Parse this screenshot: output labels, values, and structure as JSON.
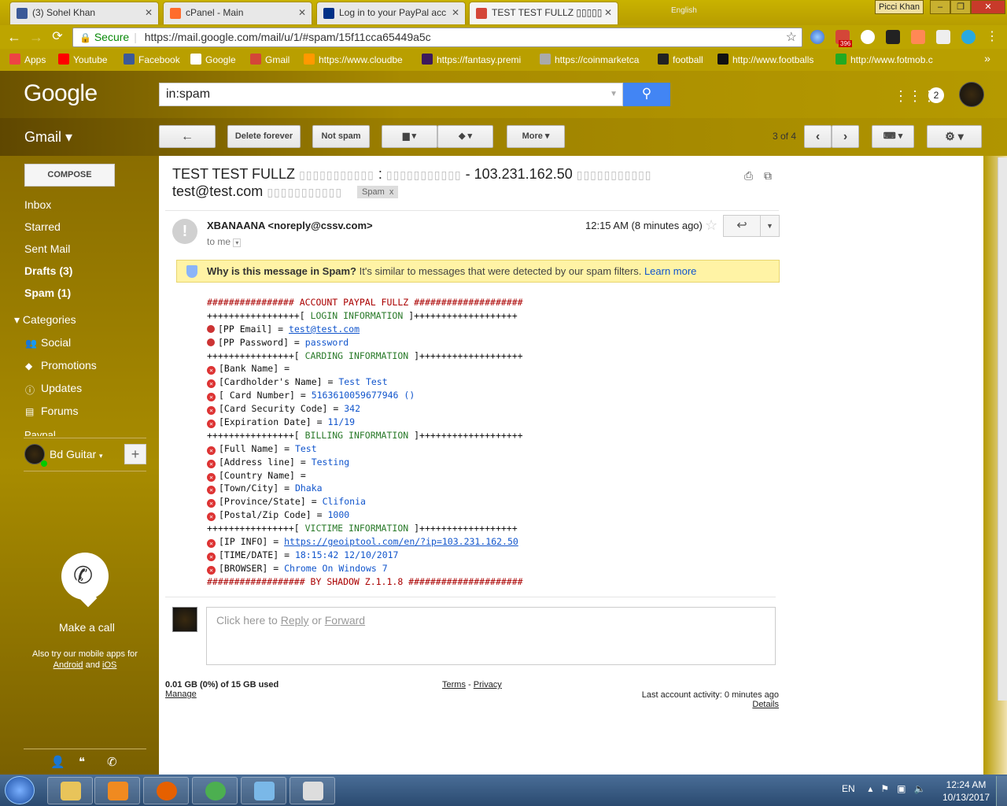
{
  "browser": {
    "tabs": [
      {
        "label": "(3) Sohel Khan",
        "icon": "facebook-icon",
        "color": "#3b5998"
      },
      {
        "label": "cPanel - Main",
        "icon": "cpanel-icon",
        "color": "#ff6c2c"
      },
      {
        "label": "Log in to your PayPal acc",
        "icon": "paypal-icon",
        "color": "#003087"
      },
      {
        "label": "TEST TEST FULLZ ▯▯▯▯▯",
        "icon": "gmail-icon",
        "color": "#d44638"
      }
    ],
    "profile_name": "Picci Khan",
    "language": "English",
    "omnibox": {
      "secure_label": "Secure",
      "url": "https://mail.google.com/mail/u/1/#spam/15f11cca65449a5c"
    },
    "bookmarks": [
      {
        "label": "Apps",
        "color": "#e44"
      },
      {
        "label": "Youtube",
        "color": "#f00"
      },
      {
        "label": "Facebook",
        "color": "#3b5998"
      },
      {
        "label": "Google",
        "color": "#fff"
      },
      {
        "label": "Gmail",
        "color": "#d44638"
      },
      {
        "label": "https://www.cloudbe",
        "color": "#f90"
      },
      {
        "label": "https://fantasy.premi",
        "color": "#3d195b"
      },
      {
        "label": "https://coinmarketca",
        "color": "#aaa"
      },
      {
        "label": "football",
        "color": "#222"
      },
      {
        "label": "http://www.footballs",
        "color": "#111"
      },
      {
        "label": "http://www.fotmob.c",
        "color": "#2a2"
      }
    ],
    "ext_badge": "396"
  },
  "gmail": {
    "logo": "Google",
    "search_query": "in:spam",
    "notifications": "2",
    "app_label": "Gmail",
    "toolbar": {
      "back_label": "←",
      "delete_label": "Delete forever",
      "notspam_label": "Not spam",
      "more_label": "More",
      "page_count": "3 of 4"
    },
    "compose_label": "COMPOSE",
    "nav": [
      {
        "label": "Inbox",
        "bold": false
      },
      {
        "label": "Starred",
        "bold": false
      },
      {
        "label": "Sent Mail",
        "bold": false
      },
      {
        "label": "Drafts (3)",
        "bold": true
      },
      {
        "label": "Spam (1)",
        "bold": true
      }
    ],
    "categories_label": "Categories",
    "categories": [
      {
        "label": "Social",
        "icon": "people-icon"
      },
      {
        "label": "Promotions",
        "icon": "tag-icon"
      },
      {
        "label": "Updates",
        "icon": "info-icon"
      },
      {
        "label": "Forums",
        "icon": "chat-icon"
      }
    ],
    "cut_item": "Paypal",
    "hangout_user": "Bd Guitar",
    "make_call": "Make a call",
    "mobile_text": "Also try our mobile apps for",
    "android": "Android",
    "and": "and",
    "ios": "iOS"
  },
  "message": {
    "subject_start": "TEST TEST FULLZ",
    "subject_colon": ":",
    "subject_ip": "- 103.231.162.50",
    "subject_email": "test@test.com",
    "garble": "▯▯▯▯▯▯▯▯▯▯▯",
    "label": "Spam",
    "sender": "XBANAANA <noreply@cssv.com>",
    "to": "to me",
    "time": "12:15 AM (8 minutes ago)",
    "spam_banner": {
      "title": "Why is this message in Spam?",
      "text": "It's similar to messages that were detected by our spam filters.",
      "link": "Learn more"
    },
    "lines": [
      {
        "t": "################ ACCOUNT PAYPAL FULLZ ####################",
        "style": "head"
      },
      {
        "t": "+++++++++++++++++[ LOGIN INFORMATION ]+++++++++++++++++++",
        "style": "sect"
      },
      {
        "k": "[PP Email] = ",
        "v": "test@test.com",
        "link": true,
        "mark": "dot"
      },
      {
        "k": "[PP Password] = ",
        "v": "password",
        "mark": "dot"
      },
      {
        "t": "++++++++++++++++[ CARDING INFORMATION ]+++++++++++++++++++",
        "style": "sect"
      },
      {
        "k": "[Bank Name] = ",
        "v": "",
        "mark": "x"
      },
      {
        "k": "[Cardholder's Name] = ",
        "v": "Test Test",
        "mark": "x"
      },
      {
        "k": "[ Card Number] = ",
        "v": "5163610059677946 ()",
        "mark": "x"
      },
      {
        "k": "[Card Security Code] = ",
        "v": "342",
        "mark": "x"
      },
      {
        "k": "[Expiration Date] = ",
        "v": "11/19",
        "mark": "x"
      },
      {
        "t": "++++++++++++++++[ BILLING INFORMATION ]+++++++++++++++++++",
        "style": "sect"
      },
      {
        "k": "[Full Name] = ",
        "v": "Test",
        "mark": "x"
      },
      {
        "k": "[Address line] = ",
        "v": "Testing",
        "mark": "x"
      },
      {
        "k": "[Country Name] = ",
        "v": "",
        "mark": "x"
      },
      {
        "k": "[Town/City] = ",
        "v": "Dhaka",
        "mark": "x"
      },
      {
        "k": "[Province/State] = ",
        "v": "Clifonia",
        "mark": "x"
      },
      {
        "k": "[Postal/Zip Code] = ",
        "v": "1000",
        "mark": "x"
      },
      {
        "t": "++++++++++++++++[ VICTIME INFORMATION ]++++++++++++++++++",
        "style": "sect"
      },
      {
        "k": "[IP INFO] = ",
        "v": "https://geoiptool.com/en/?ip=103.231.162.50",
        "link": true,
        "mark": "x"
      },
      {
        "k": "[TIME/DATE] = ",
        "v": "18:15:42 12/10/2017",
        "mark": "x"
      },
      {
        "k": "[BROWSER] = ",
        "v": "Chrome On Windows 7",
        "mark": "x"
      },
      {
        "t": "################## BY SHADOW Z.1.1.8 #####################",
        "style": "head"
      }
    ],
    "reply_placeholder_pre": "Click here to ",
    "reply_link": "Reply",
    "reply_or": " or ",
    "forward_link": "Forward"
  },
  "footer": {
    "storage": "0.01 GB (0%) of 15 GB used",
    "manage": "Manage",
    "terms": "Terms",
    "dash": "-",
    "privacy": "Privacy",
    "activity": "Last account activity: 0 minutes ago",
    "details": "Details"
  },
  "taskbar": {
    "lang": "EN",
    "time": "12:24 AM",
    "date": "10/13/2017",
    "apps": [
      {
        "name": "explorer-icon",
        "color": "#e8c45a"
      },
      {
        "name": "media-player-icon",
        "color": "#f08a20"
      },
      {
        "name": "firefox-icon",
        "color": "#e66000"
      },
      {
        "name": "chrome-icon",
        "color": "#4caf50"
      },
      {
        "name": "notepad-icon",
        "color": "#7ab8e8"
      },
      {
        "name": "paint-icon",
        "color": "#ddd"
      }
    ]
  }
}
